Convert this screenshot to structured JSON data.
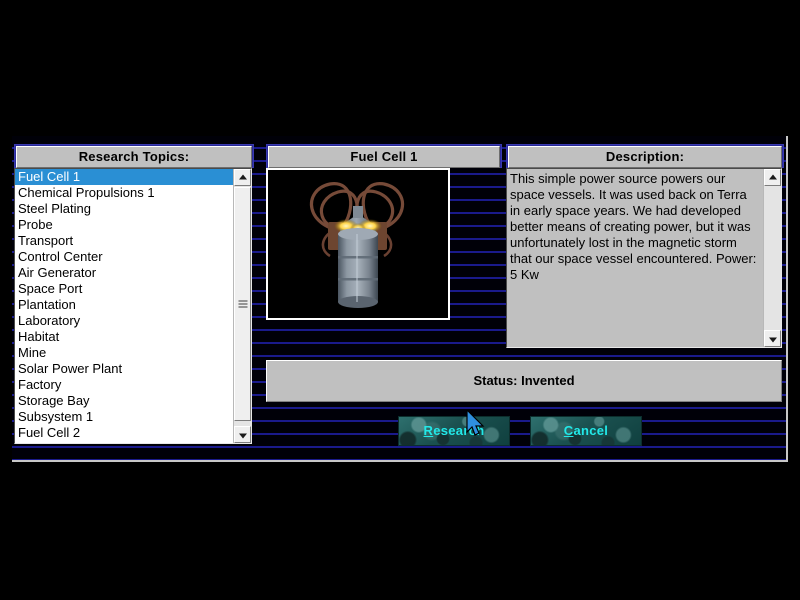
{
  "window": {
    "background_color": "#000008",
    "scanline_color": "#1a1a8c"
  },
  "panels": {
    "topics_header": "Research Topics:",
    "item_header": "Fuel Cell 1",
    "description_header": "Description:"
  },
  "research_list": {
    "selected_index": 0,
    "selected_color": "#2a8fd4",
    "items": [
      "Fuel Cell 1",
      "Chemical Propulsions 1",
      "Steel Plating",
      "Probe",
      "Transport",
      "Control Center",
      "Air Generator",
      "Space Port",
      "Plantation",
      "Laboratory",
      "Habitat",
      "Mine",
      "Solar Power Plant",
      "Factory",
      "Storage Bay",
      "Subsystem 1",
      "Fuel Cell 2"
    ]
  },
  "preview": {
    "alt": "fuel-cell-render"
  },
  "description": {
    "text": "This simple power source powers our space vessels.  It was used back on Terra in early space years. We had developed better means of creating power, but it was unfortunately lost in the magnetic storm that our space vessel encountered.  Power: 5 Kw"
  },
  "status": {
    "text": "Status: Invented"
  },
  "buttons": {
    "research": {
      "accel": "R",
      "rest": "esearch"
    },
    "cancel": {
      "accel": "C",
      "rest": "ancel"
    },
    "text_color": "#22e8e8"
  },
  "scrollbars": {
    "up_arrow": "triangle-up-icon",
    "down_arrow": "triangle-down-icon",
    "grip": "grip-lines-icon"
  }
}
